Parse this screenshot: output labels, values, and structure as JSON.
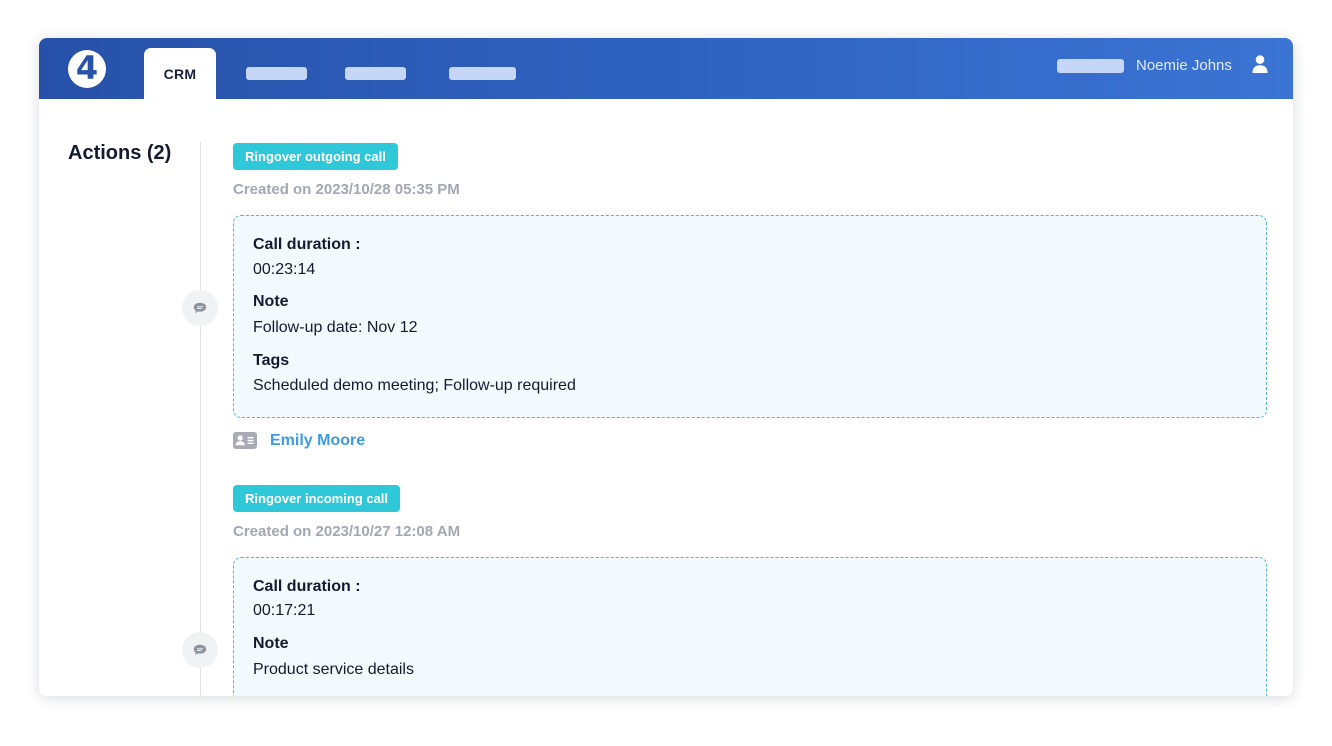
{
  "header": {
    "logo_text": "4",
    "active_tab": "CRM",
    "user_name": "Noemie Johns",
    "gradient_start": "#2751a8",
    "gradient_end": "#3b74d3"
  },
  "sidebar": {
    "title": "Actions (2)"
  },
  "actions": [
    {
      "type": "Ringover outgoing call",
      "created": "Created on 2023/10/28 05:35 PM",
      "call_duration_label": "Call duration :",
      "call_duration": "00:23:14",
      "note_label": "Note",
      "note": "Follow-up date: Nov 12",
      "tags_label": "Tags",
      "tags": "Scheduled demo meeting; Follow-up required",
      "contact": "Emily Moore",
      "icon": "chat-bubble-icon"
    },
    {
      "type": "Ringover incoming call",
      "created": "Created on 2023/10/27 12:08 AM",
      "call_duration_label": "Call duration :",
      "call_duration": "00:17:21",
      "note_label": "Note",
      "note": "Product service details",
      "icon": "chat-bubble-icon"
    }
  ],
  "colors": {
    "badge": "#2ec8d9",
    "contact_link": "#3e9be0",
    "card_border": "#55b3cf",
    "card_bg": "#f3fafd"
  }
}
